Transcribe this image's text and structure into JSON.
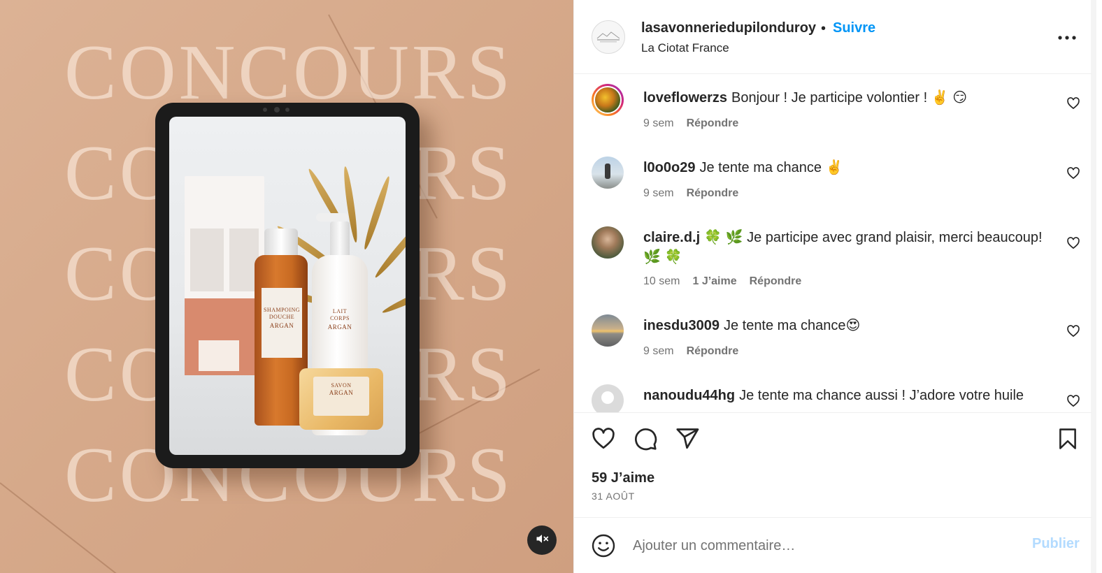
{
  "media": {
    "background_word": "CONCOURS",
    "mute_icon": "speaker-muted-icon",
    "product_labels": {
      "shampoo_line1": "SHAMPOING",
      "shampoo_line2": "DOUCHE",
      "shampoo_line3": "ARGAN",
      "lait_line1": "LAIT",
      "lait_line2": "CORPS",
      "lait_line3": "ARGAN",
      "soap_line1": "SAVON",
      "soap_line2": "ARGAN"
    }
  },
  "header": {
    "username": "lasavonneriedupilonduroy",
    "separator": "•",
    "follow_label": "Suivre",
    "location": "La Ciotat France",
    "more_icon": "more-options-icon"
  },
  "comments": [
    {
      "user": "loveflowerzs",
      "text": "Bonjour ! Je participe volontier ! ✌️ 😏",
      "time": "9 sem",
      "likes": "",
      "reply": "Répondre"
    },
    {
      "user": "l0o0o29",
      "text": "Je tente ma chance ✌️",
      "time": "9 sem",
      "likes": "",
      "reply": "Répondre"
    },
    {
      "user": "claire.d.j",
      "text": "🍀 🌿 Je participe avec grand plaisir, merci beaucoup! 🌿 🍀",
      "time": "10 sem",
      "likes": "1 J’aime",
      "reply": "Répondre"
    },
    {
      "user": "inesdu3009",
      "text": "Je tente ma chance😍",
      "time": "9 sem",
      "likes": "",
      "reply": "Répondre"
    },
    {
      "user": "nanoudu44hg",
      "text": "Je tente ma chance aussi ! J’adore votre huile",
      "time": "",
      "likes": "",
      "reply": ""
    }
  ],
  "actions": {
    "like_icon": "heart-icon",
    "comment_icon": "comment-icon",
    "share_icon": "share-icon",
    "save_icon": "bookmark-icon"
  },
  "stats": {
    "likes": "59 J’aime",
    "date": "31 AOÛT"
  },
  "add_comment": {
    "placeholder": "Ajouter un commentaire…",
    "publish_label": "Publier",
    "emoji_icon": "emoji-icon"
  },
  "colors": {
    "accent": "#0095f6",
    "publish_disabled": "#b3dbff",
    "text": "#262626",
    "secondary": "#737373",
    "background": "#d6a98a"
  }
}
